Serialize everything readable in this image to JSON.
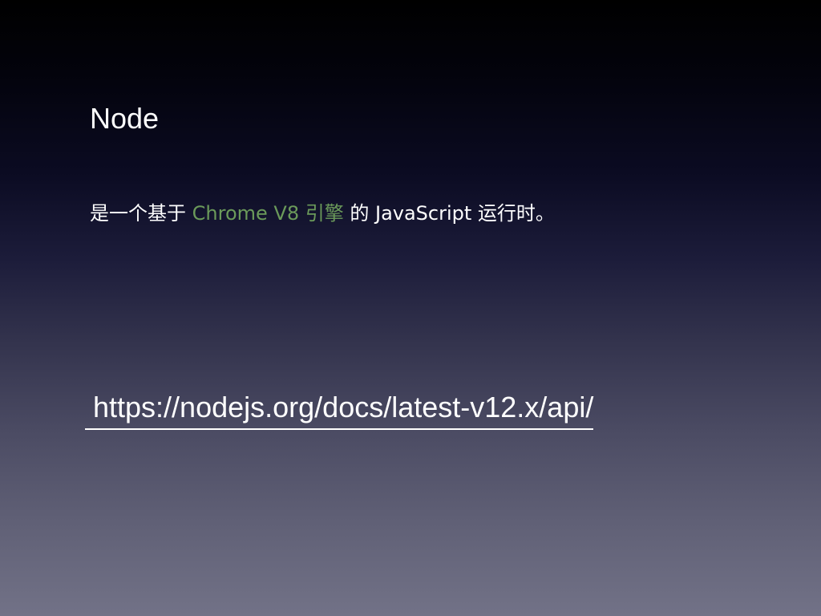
{
  "slide": {
    "title": "Node",
    "description": {
      "prefix": "是一个基于 ",
      "highlight": "Chrome V8 引擎",
      "suffix": " 的 JavaScript 运行时。"
    },
    "link": {
      "text": "https://nodejs.org/docs/latest-v12.x/api/"
    }
  },
  "colors": {
    "text": "#ffffff",
    "highlight": "#6b9a5a",
    "background_top": "#000000",
    "background_bottom": "#727287"
  }
}
